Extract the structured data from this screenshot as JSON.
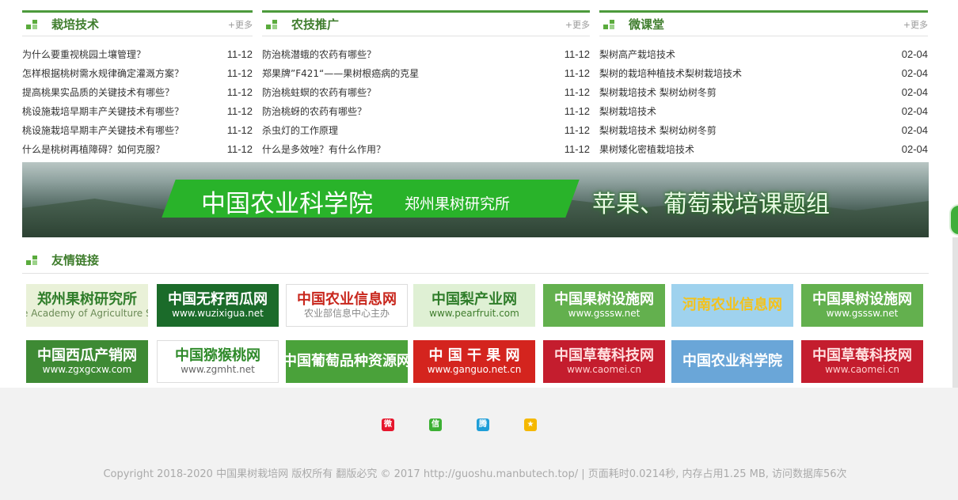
{
  "columns": [
    {
      "title": "栽培技术",
      "more": "+更多",
      "items": [
        {
          "title": "为什么要重视桃园土壤管理？",
          "date": "11-12"
        },
        {
          "title": "怎样根据桃树需水规律确定灌溉方案？",
          "date": "11-12"
        },
        {
          "title": "提高桃果实品质的关键技术有哪些？",
          "date": "11-12"
        },
        {
          "title": "桃设施栽培早期丰产关键技术有哪些？",
          "date": "11-12"
        },
        {
          "title": "桃设施栽培早期丰产关键技术有哪些？",
          "date": "11-12"
        },
        {
          "title": "什么是桃树再植障碍？如何克服？",
          "date": "11-12"
        }
      ]
    },
    {
      "title": "农技推广",
      "more": "+更多",
      "items": [
        {
          "title": "防治桃潜蛾的农药有哪些？",
          "date": "11-12"
        },
        {
          "title": "郑果牌”F421“——果树根癌病的克星",
          "date": "11-12"
        },
        {
          "title": "防治桃蛀螟的农药有哪些？",
          "date": "11-12"
        },
        {
          "title": "防治桃蚜的农药有哪些？",
          "date": "11-12"
        },
        {
          "title": "杀虫灯的工作原理",
          "date": "11-12"
        },
        {
          "title": "什么是多效唑？有什么作用？",
          "date": "11-12"
        }
      ]
    },
    {
      "title": "微课堂",
      "more": "+更多",
      "items": [
        {
          "title": "梨树高产栽培技术",
          "date": "02-04"
        },
        {
          "title": "梨树的栽培种植技术梨树栽培技术",
          "date": "02-04"
        },
        {
          "title": "梨树栽培技术 梨树幼树冬剪",
          "date": "02-04"
        },
        {
          "title": "梨树栽培技术",
          "date": "02-04"
        },
        {
          "title": "梨树栽培技术 梨树幼树冬剪",
          "date": "02-04"
        },
        {
          "title": "果树矮化密植栽培技术",
          "date": "02-04"
        }
      ]
    }
  ],
  "banner": {
    "main": "中国农业科学院",
    "sub": "郑州果树研究所",
    "right": "苹果、葡萄栽培课题组"
  },
  "links": {
    "title": "友情链接",
    "items": [
      {
        "line1": "郑州果树研究所",
        "line2": "inese Academy of Agriculture Scien",
        "bg": "#e9f1d8",
        "fg": "#2f7d2a",
        "fg2": "#6a8a55"
      },
      {
        "line1": "中国无籽西瓜网",
        "line2": "www.wuzixigua.net",
        "bg": "#1b6b2a",
        "fg": "#ffffff",
        "fg2": "#ffffff"
      },
      {
        "line1": "中国农业信息网",
        "line2": "农业部信息中心主办",
        "bg": "#ffffff",
        "fg": "#c8261c",
        "fg2": "#888888"
      },
      {
        "line1": "中国梨产业网",
        "line2": "www.pearfruit.com",
        "bg": "#dff0d4",
        "fg": "#2f7d2a",
        "fg2": "#3f7d2d"
      },
      {
        "line1": "中国果树设施网",
        "line2": "www.gsssw.net",
        "bg": "#63b04e",
        "fg": "#ffffff",
        "fg2": "#ffffff"
      },
      {
        "line1": "河南农业信息网",
        "line2": "",
        "bg": "#9fd2ee",
        "fg": "#f3c21c",
        "fg2": "#2e6a9a"
      },
      {
        "line1": "中国果树设施网",
        "line2": "www.gsssw.net",
        "bg": "#63b04e",
        "fg": "#ffffff",
        "fg2": "#ffffff"
      },
      {
        "line1": "中国西瓜产销网",
        "line2": "www.zgxgcxw.com",
        "bg": "#3e8a34",
        "fg": "#ffffff",
        "fg2": "#ffffff"
      },
      {
        "line1": "中国猕猴桃网",
        "line2": "www.zgmht.net",
        "bg": "#ffffff",
        "fg": "#2f8a2a",
        "fg2": "#666666"
      },
      {
        "line1": "中国葡萄品种资源网",
        "line2": "",
        "bg": "#4aa23a",
        "fg": "#ffffff",
        "fg2": "#ffffff"
      },
      {
        "line1": "中 国 干 果 网",
        "line2": "www.ganguo.net.cn",
        "bg": "#d4241e",
        "fg": "#ffffff",
        "fg2": "#ffffff"
      },
      {
        "line1": "中国草莓科技网",
        "line2": "www.caomei.cn",
        "bg": "#c41d2e",
        "fg": "#ffe0e0",
        "fg2": "#ffcccc"
      },
      {
        "line1": "中国农业科学院",
        "line2": "",
        "bg": "#6aa6d8",
        "fg": "#ffffff",
        "fg2": "#ffffff"
      },
      {
        "line1": "中国草莓科技网",
        "line2": "www.caomei.cn",
        "bg": "#c41d2e",
        "fg": "#ffe0e0",
        "fg2": "#ffcccc"
      }
    ]
  },
  "footer": {
    "share_icons": [
      {
        "name": "weibo-icon",
        "glyph": "微",
        "color": "#e6162d"
      },
      {
        "name": "wechat-icon",
        "glyph": "信",
        "color": "#3cb034"
      },
      {
        "name": "tencent-weibo-icon",
        "glyph": "腾",
        "color": "#1f9ed8"
      },
      {
        "name": "qzone-icon",
        "glyph": "★",
        "color": "#f5b800"
      }
    ],
    "copyright": "Copyright 2018-2020 中国果树栽培网 版权所有 翻版必究 © 2017 http://guoshu.manbutech.top/ | 页面耗时0.0214秒, 内存占用1.25 MB, 访问数据库56次"
  },
  "colors": {
    "accent": "#4c9a3c",
    "title": "#3f7d2d",
    "footer_bg": "#f2f2f2"
  }
}
